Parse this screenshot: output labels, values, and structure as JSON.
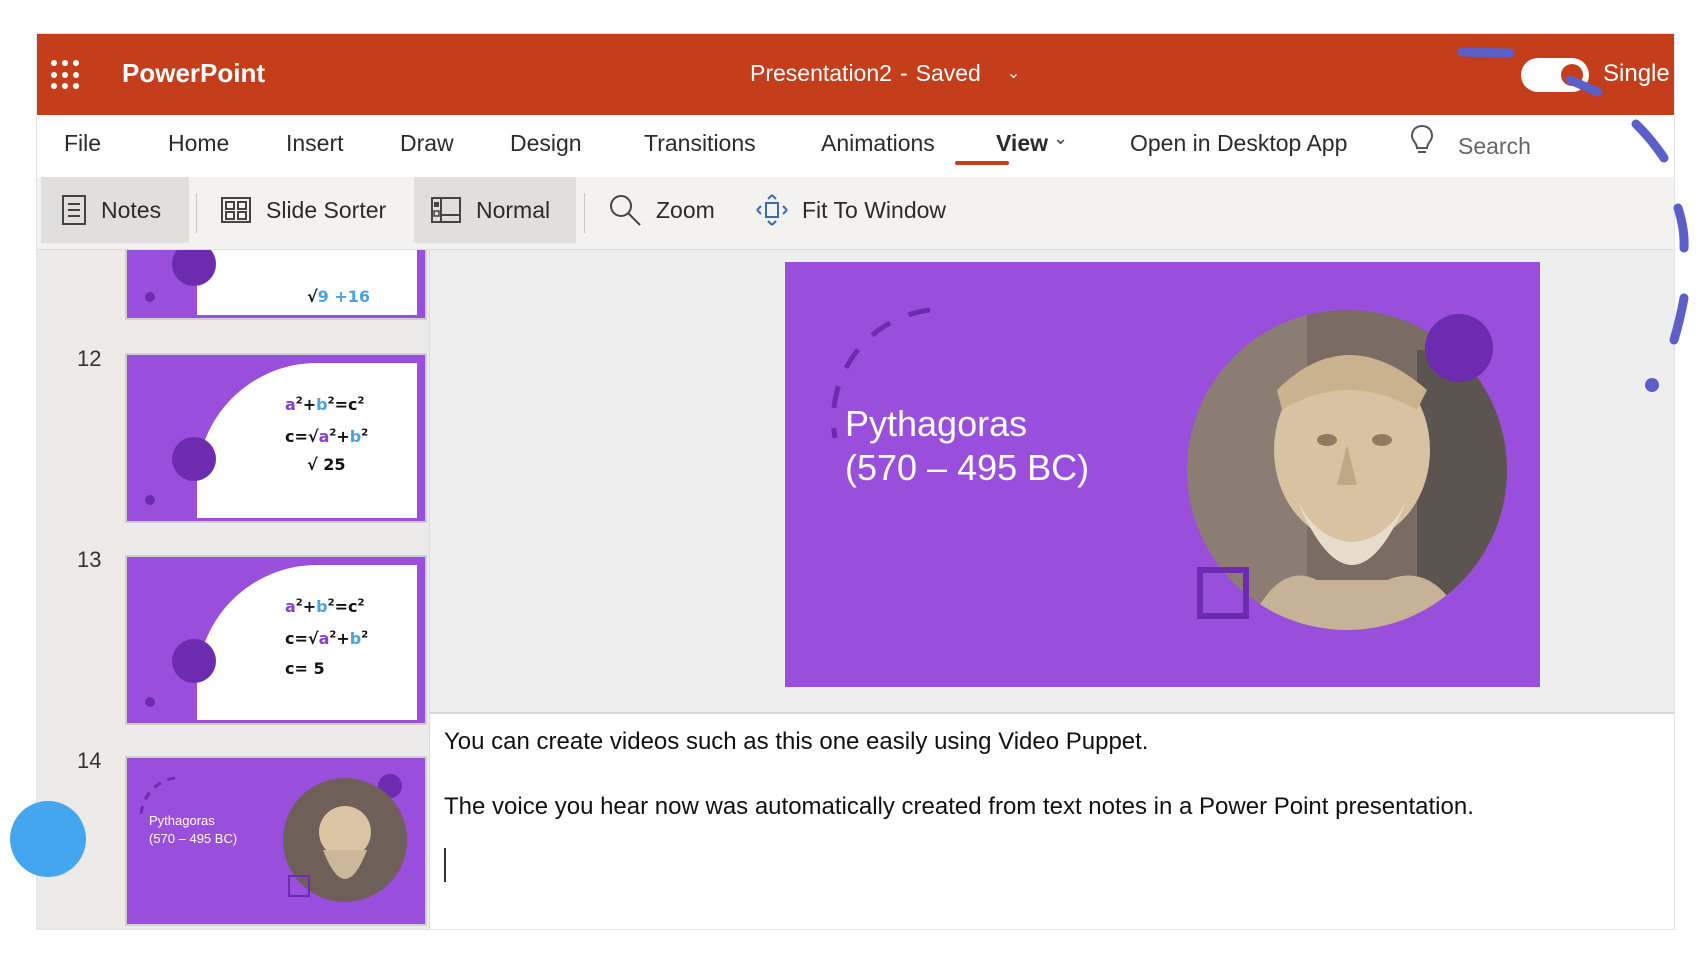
{
  "titlebar": {
    "app_name": "PowerPoint",
    "doc_name": "Presentation2",
    "separator": "-",
    "save_status": "Saved",
    "view_mode": "Single"
  },
  "menu": {
    "tabs": [
      "File",
      "Home",
      "Insert",
      "Draw",
      "Design",
      "Transitions",
      "Animations",
      "View"
    ],
    "active_tab": "View",
    "open_desktop": "Open in Desktop App",
    "search": "Search"
  },
  "ribbon": {
    "notes": "Notes",
    "slide_sorter": "Slide Sorter",
    "normal": "Normal",
    "zoom": "Zoom",
    "fit": "Fit To Window"
  },
  "thumbnails": [
    {
      "number": "",
      "math": [
        "9 +16"
      ]
    },
    {
      "number": "12",
      "math": [
        "a2+b2=c2",
        "c=√a2+b2",
        "√ 25"
      ]
    },
    {
      "number": "13",
      "math": [
        "a2+b2=c2",
        "c=√a2+b2",
        "c= 5"
      ]
    },
    {
      "number": "14",
      "title_line1": "Pythagoras",
      "title_line2": "(570 – 495 BC)"
    }
  ],
  "slide": {
    "title_line1": "Pythagoras",
    "title_line2": "(570 – 495 BC)"
  },
  "notes": {
    "line1": "You can create videos such as this one easily using Video Puppet.",
    "line2": "The voice you hear now was automatically created from text notes in a Power Point presentation."
  },
  "colors": {
    "brand": "#c43e1c",
    "slide_purple": "#9a4fdc",
    "deco_purple": "#6d2bb0",
    "annotation": "#5b5fc7",
    "cursor": "#45a6f0"
  }
}
